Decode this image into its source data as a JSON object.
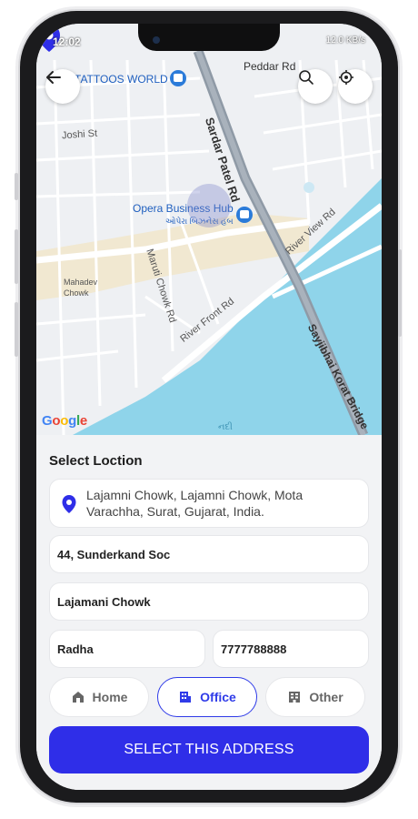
{
  "status": {
    "time": "12:02",
    "right": "12.0 KB/s"
  },
  "map": {
    "labels": {
      "tattoos": "TATTOOS WORLD",
      "peddar": "Peddar Rd",
      "joshi": "Joshi St",
      "opera": "Opera Business Hub",
      "opera_gu": "ઓપેરા બિઝનેસ હબ",
      "mahadev": "Mahadev Chowk",
      "river_front": "River Front Rd",
      "maruti": "Maruti Chowk Rd",
      "sardar": "Sardar Patel Rd",
      "river_view": "River View Rd",
      "sayjibhai": "Sayjibhai Korat Bridge",
      "google": "Google",
      "water_label": "નદી"
    }
  },
  "sheet": {
    "title": "Select Loction",
    "selected_location": "Lajamni Chowk, Lajamni Chowk, Mota Varachha, Surat, Gujarat, India.",
    "fields": {
      "address_line": "44, Sunderkand Soc",
      "landmark": "Lajamani Chowk",
      "name": "Radha",
      "phone": "7777788888"
    },
    "types": [
      {
        "label": "Home",
        "active": false
      },
      {
        "label": "Office",
        "active": true
      },
      {
        "label": "Other",
        "active": false
      }
    ],
    "cta": "SELECT THIS ADDRESS"
  },
  "colors": {
    "accent": "#2f2ee8",
    "water": "#8fd4ea"
  }
}
